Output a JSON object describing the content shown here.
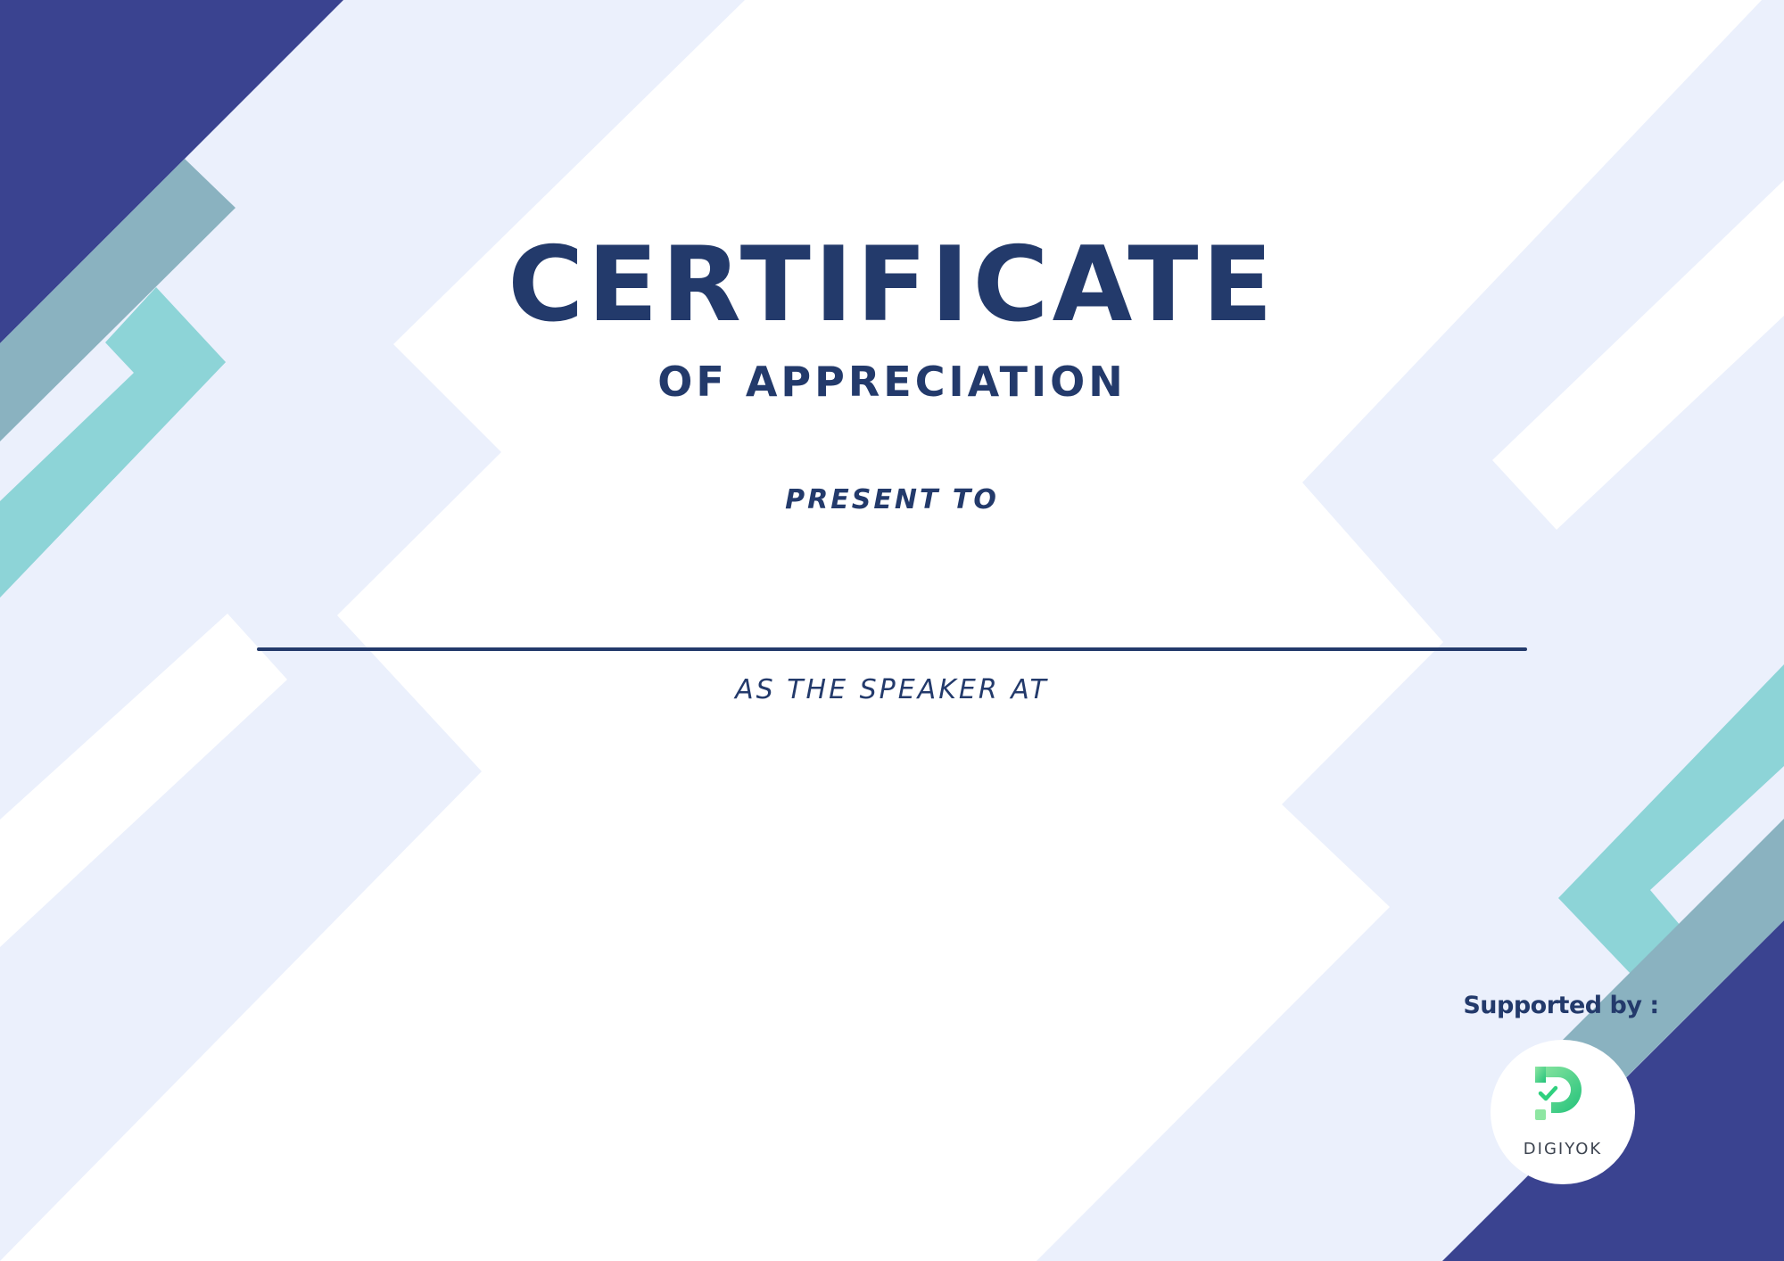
{
  "certificate": {
    "title": "CERTIFICATE",
    "subtitle": "OF APPRECIATION",
    "present_label": "PRESENT TO",
    "speaker_label": "AS THE SPEAKER AT"
  },
  "sponsor": {
    "label": "Supported by :",
    "logo_text": "DIGIYOK",
    "logo_icon": "digiyok-logo-icon"
  },
  "colors": {
    "navy": "#3a4390",
    "text": "#233a6b",
    "pale_blue": "#ebf0fc",
    "teal": "#8dd4d7",
    "slate_teal": "#8ab2c0",
    "logo_green": "#2fd07e"
  }
}
